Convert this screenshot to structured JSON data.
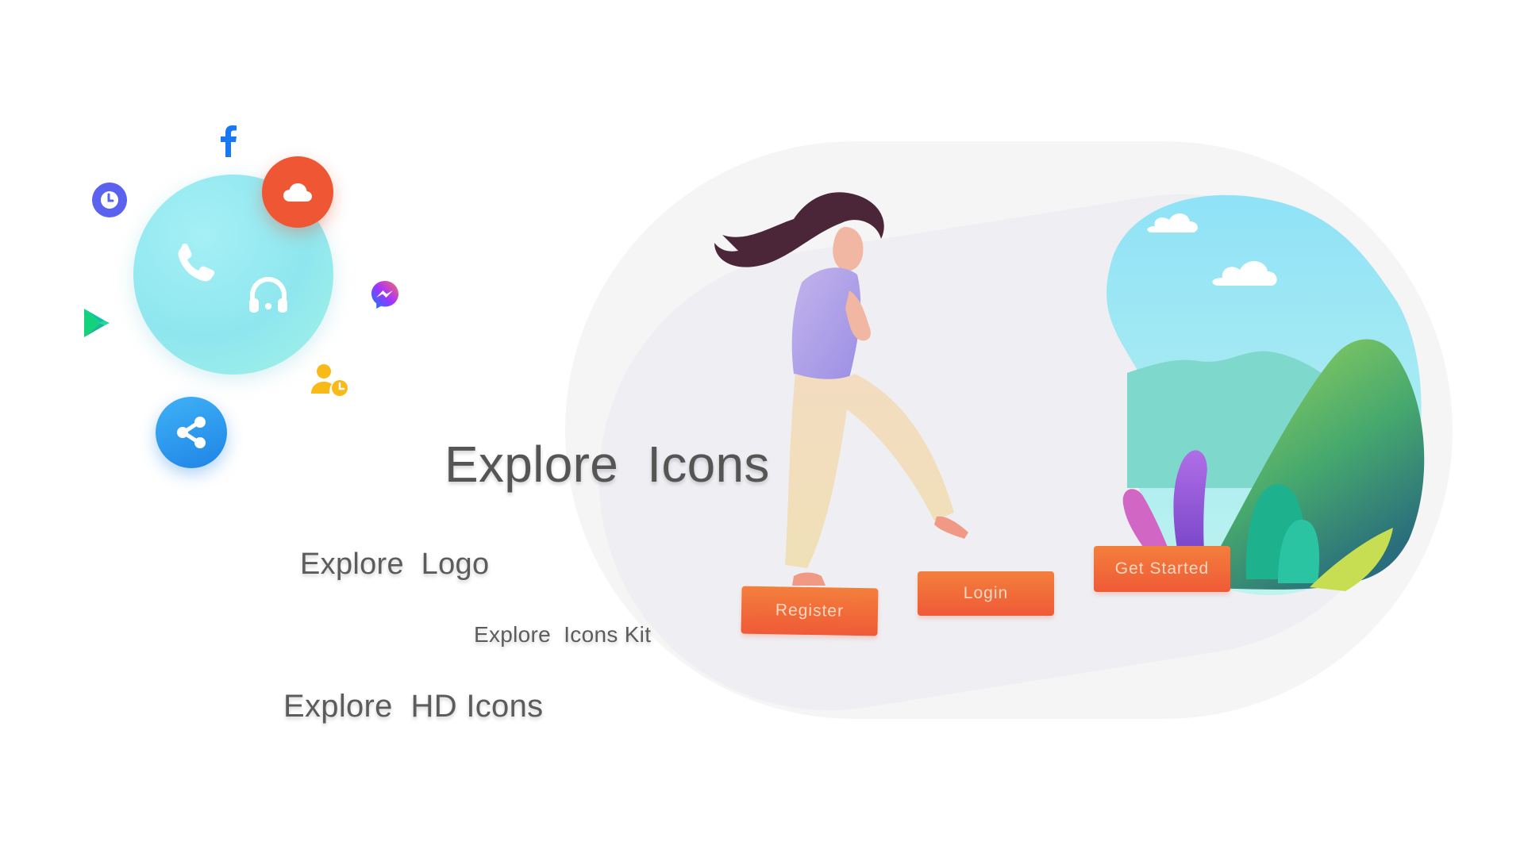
{
  "headings": {
    "explore_icons": "Explore  Icons",
    "explore_logo": "Explore  Logo",
    "explore_icons_kit": "Explore  Icons Kit",
    "explore_hd_icons": "Explore  HD Icons"
  },
  "illustration": {
    "register_label": "Register",
    "login_label": "Login",
    "get_started_label": "Get Started"
  },
  "icons": [
    "facebook-icon",
    "clock-icon",
    "cloud-icon",
    "phone-icon",
    "headset-icon",
    "play-store-icon",
    "messenger-icon",
    "user-clock-icon",
    "share-icon"
  ],
  "colors": {
    "accent_orange": "#ef5734",
    "share_blue": "#1f84e6",
    "clock_purple": "#5b63ee",
    "circle_cyan": "#8fe6ee",
    "facebook_blue": "#1877f2",
    "user_yellow": "#f9b916"
  }
}
